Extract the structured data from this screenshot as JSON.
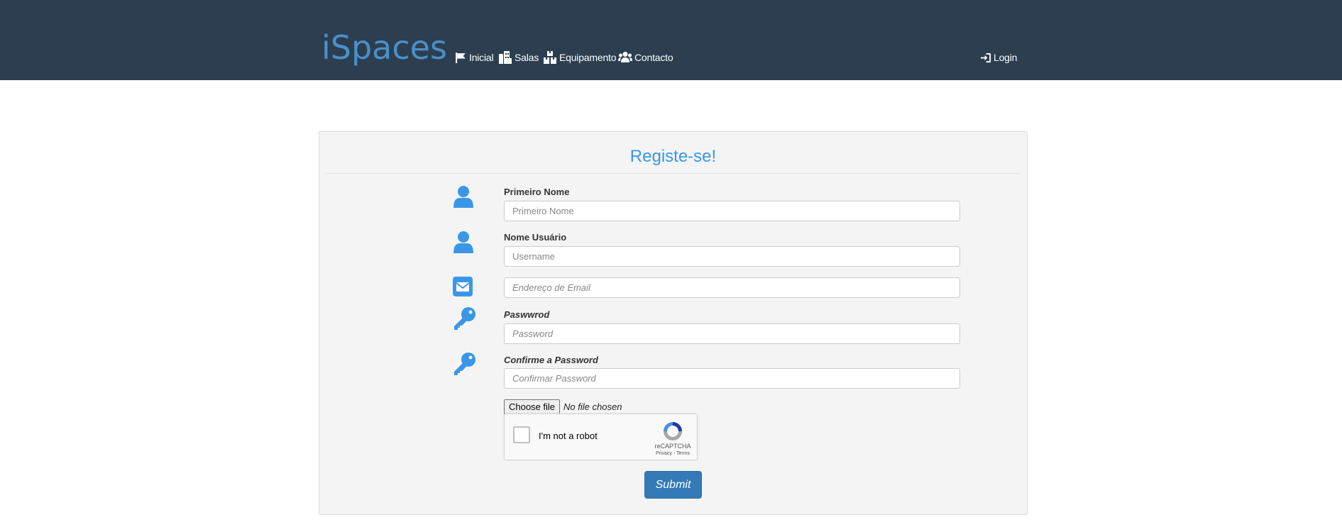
{
  "navbar": {
    "brand": "iSpaces",
    "items": [
      {
        "label": "Inicial",
        "icon": "flag-icon"
      },
      {
        "label": "Salas",
        "icon": "building-icon"
      },
      {
        "label": "Equipamento",
        "icon": "cubes-icon"
      },
      {
        "label": "Contacto",
        "icon": "users-icon"
      }
    ],
    "login": {
      "label": "Login",
      "icon": "sign-in-icon"
    }
  },
  "form": {
    "title": "Registe-se!",
    "fields": [
      {
        "label": "Primeiro Nome",
        "placeholder": "Primeiro Nome",
        "icon": "user-icon"
      },
      {
        "label": "Nome Usuário",
        "placeholder": "Username",
        "icon": "user-icon"
      },
      {
        "label": "",
        "placeholder": "Endereço de Email",
        "icon": "envelope-icon"
      },
      {
        "label": "Paswwrod",
        "placeholder": "Password",
        "icon": "key-icon"
      },
      {
        "label": "Confirme a Password",
        "placeholder": "Confirmar Password",
        "icon": "key-icon"
      }
    ],
    "file": {
      "button_label": "Choose file",
      "status": "No file chosen"
    },
    "recaptcha": {
      "label": "I'm not a robot",
      "brand": "reCAPTCHA",
      "links": "Privacy - Terms"
    },
    "submit_label": "Submit"
  },
  "colors": {
    "navbar_bg": "#2c3e50",
    "brand": "#4a90c8",
    "accent_blue": "#3a97e8",
    "panel_bg": "#f4f4f4",
    "submit_bg": "#337ab7"
  }
}
